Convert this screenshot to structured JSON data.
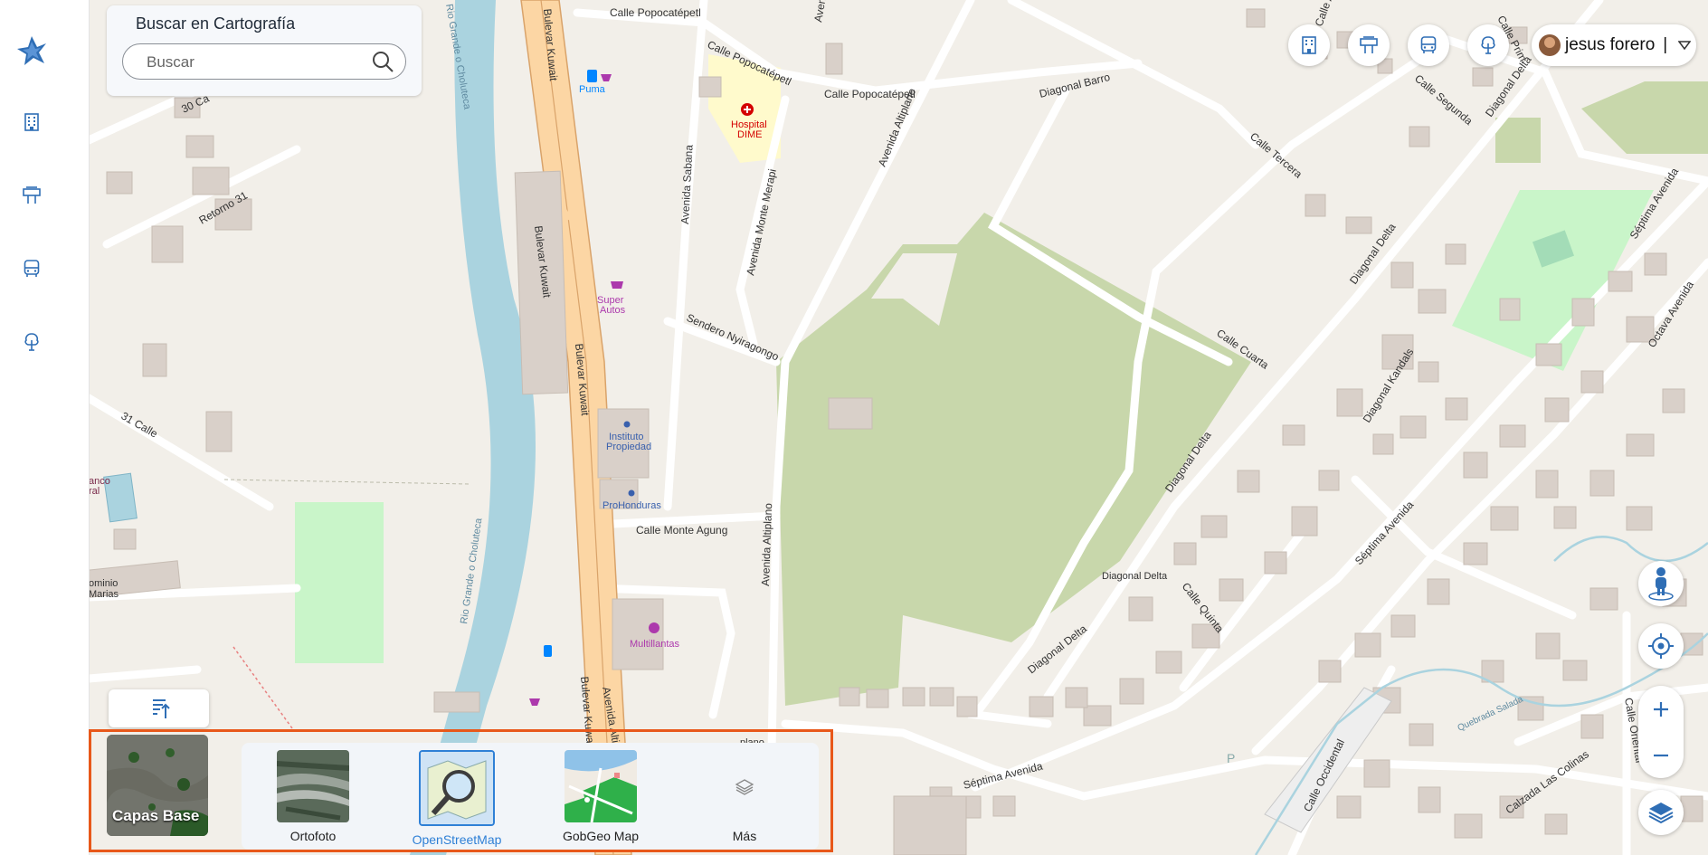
{
  "search": {
    "title": "Buscar en Cartografía",
    "placeholder": "Buscar"
  },
  "user": {
    "name": "jesus forero",
    "separator": "|"
  },
  "rail": {
    "items": [
      "building-icon",
      "signpost-icon",
      "bus-icon",
      "tree-icon"
    ]
  },
  "topbar": {
    "items": [
      "building-icon",
      "signpost-icon",
      "bus-icon",
      "tree-icon"
    ]
  },
  "basemaps": {
    "current_label": "Capas Base",
    "items": [
      {
        "label": "Ortofoto",
        "selected": false
      },
      {
        "label": "OpenStreetMap",
        "selected": true
      },
      {
        "label": "GobGeo Map",
        "selected": false
      },
      {
        "label": "Más",
        "selected": false
      }
    ]
  },
  "map_labels": {
    "calle_popocatepetl_1": "Calle Popocatépetl",
    "calle_popocatepetl_2": "Calle Popocatépetl",
    "calle_popocatepetl_3": "Calle Popocatépetl",
    "puma": "Puma",
    "hospital": "Hospital",
    "hospital2": "DIME",
    "bulevar_kuwait_1": "Bulevar Kuwait",
    "bulevar_kuwait_2": "Bulevar Kuwait",
    "bulevar_kuwait_3": "Bulevar Kuwait",
    "bulevar_kuwait_4": "Bulevar Kuwait",
    "avenida_sabana": "Avenida Sabana",
    "avenida_monte_merapi": "Avenida Monte Merapi",
    "avenida_altiplano_1": "Avenida Altiplano",
    "avenida_altiplano_2": "Avenida Altiplano",
    "avenida_altiplano_3": "Avenida Altiplano",
    "super_autos1": "Super",
    "super_autos2": "Autos",
    "sendero": "Sendero Nyiragongo",
    "instituto1": "Instituto",
    "instituto2": "Propiedad",
    "prohonduras": "ProHonduras",
    "calle_monte_agung": "Calle Monte Agung",
    "multillantas": "Multillantas",
    "rio_1": "Rio Grande o Choluteca",
    "rio_2": "Rio Grande o Choluteca",
    "retorno_31": "Retorno 31",
    "c30": "30 Ca",
    "c31": "31 Calle",
    "banco1": "anco",
    "banco2": "ral",
    "dominio1": "ominio",
    "dominio2": "Marias",
    "diagonal_barro": "Diagonal Barro",
    "calle_segunda": "Calle Segunda",
    "calle_tercera": "Calle Tercera",
    "diagonal_delta_1": "Diagonal Delta",
    "diagonal_delta_2": "Diagonal Delta",
    "diagonal_delta_3": "Diagonal Delta",
    "diagonal_delta_4": "Diagonal Delta",
    "diagonal_delta_5": "Diagonal Delta",
    "calle_cuarta": "Calle Cuarta",
    "diagonal_kandals": "Diagonal Kandals",
    "septima_avenida_1": "Séptima Avenida",
    "septima_avenida_2": "Séptima Avenida",
    "septima_avenida_3": "Séptima Avenida",
    "octava_avenida": "Octava Avenida",
    "calle_quinta": "Calle Quinta",
    "calle_occidental": "Calle Occidental",
    "calle_oriental": "Calle Oriental",
    "calzada": "Calzada Las Colinas",
    "quebrada": "Quebrada Salada",
    "calle_prim": "Calle Prim",
    "calle_agu": "Calle Agu",
    "aven": "Aven",
    "plano": "plano",
    "parking": "P"
  }
}
